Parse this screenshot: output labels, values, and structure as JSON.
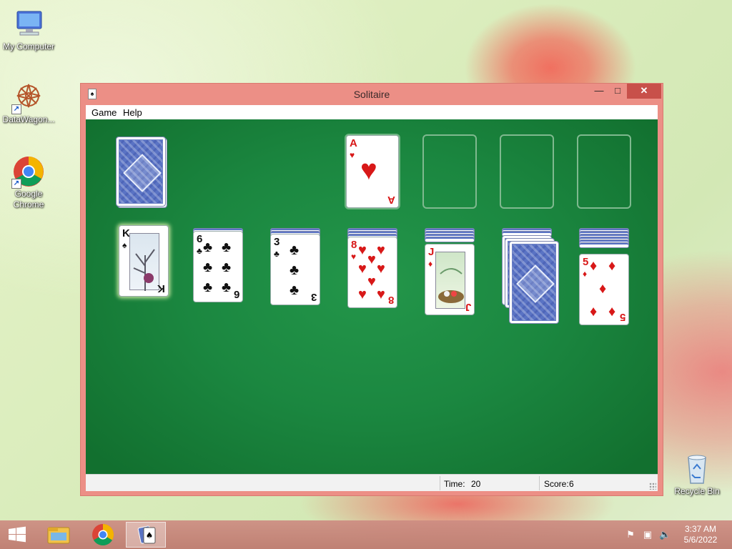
{
  "desktop": {
    "icons": [
      {
        "label": "My Computer"
      },
      {
        "label": "DataWagon..."
      },
      {
        "label": "Google Chrome"
      },
      {
        "label": "Recycle Bin"
      }
    ]
  },
  "window": {
    "title": "Solitaire",
    "controls": {
      "minimize": "—",
      "maximize": "□",
      "close": "✕"
    },
    "menu": [
      "Game",
      "Help"
    ],
    "status": {
      "time_label": "Time:",
      "time_value": "20",
      "score_label": "Score:",
      "score_value": "6"
    }
  },
  "game": {
    "stock": {
      "facedown": true
    },
    "foundations": [
      {
        "rank": "A",
        "suit": "♥",
        "color": "red"
      },
      {
        "empty": true
      },
      {
        "empty": true
      },
      {
        "empty": true
      }
    ],
    "tableau": [
      {
        "hidden": 0,
        "top": {
          "rank": "K",
          "suit": "♠",
          "color": "black"
        }
      },
      {
        "hidden": 1,
        "top": {
          "rank": "6",
          "suit": "♣",
          "color": "black"
        }
      },
      {
        "hidden": 2,
        "top": {
          "rank": "3",
          "suit": "♣",
          "color": "black"
        }
      },
      {
        "hidden": 3,
        "top": {
          "rank": "8",
          "suit": "♥",
          "color": "red"
        }
      },
      {
        "hidden": 4,
        "top": {
          "rank": "J",
          "suit": "♦",
          "color": "red"
        }
      },
      {
        "hidden": 5,
        "top": null
      },
      {
        "hidden": 6,
        "top": {
          "rank": "5",
          "suit": "♦",
          "color": "red"
        }
      }
    ]
  },
  "taskbar": {
    "start_icon": "windows-logo-icon",
    "pinned": [
      "file-explorer-icon",
      "chrome-icon",
      "solitaire-icon"
    ],
    "tray": [
      "action-center-flag-icon",
      "network-icon",
      "volume-muted-icon"
    ],
    "clock": {
      "time": "3:37 AM",
      "date": "5/6/2022"
    }
  }
}
